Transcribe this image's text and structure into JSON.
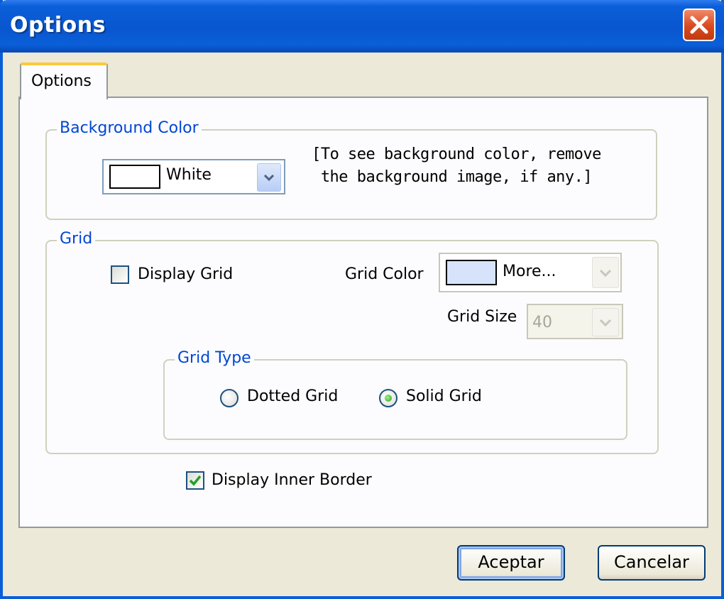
{
  "window": {
    "title": "Options"
  },
  "tab": {
    "label": "Options"
  },
  "background_color": {
    "group_label": "Background Color",
    "selected": "White",
    "swatch_color": "#ffffff",
    "note_line1": "[To see background color, remove",
    "note_line2": "the background image, if any.]"
  },
  "grid": {
    "group_label": "Grid",
    "display_grid_label": "Display Grid",
    "display_grid_checked": false,
    "grid_color_label": "Grid Color",
    "grid_color_selected": "More...",
    "grid_color_swatch": "#d7e3fb",
    "grid_size_label": "Grid Size",
    "grid_size_value": "40",
    "grid_type": {
      "group_label": "Grid Type",
      "dotted_label": "Dotted Grid",
      "solid_label": "Solid Grid",
      "selected": "Solid Grid"
    }
  },
  "display_inner_border": {
    "label": "Display Inner Border",
    "checked": true
  },
  "buttons": {
    "ok": "Aceptar",
    "cancel": "Cancelar"
  },
  "colors": {
    "title_bar": "#0a5fd8",
    "group_label": "#0046d5",
    "tab_accent": "#ffc83c"
  }
}
